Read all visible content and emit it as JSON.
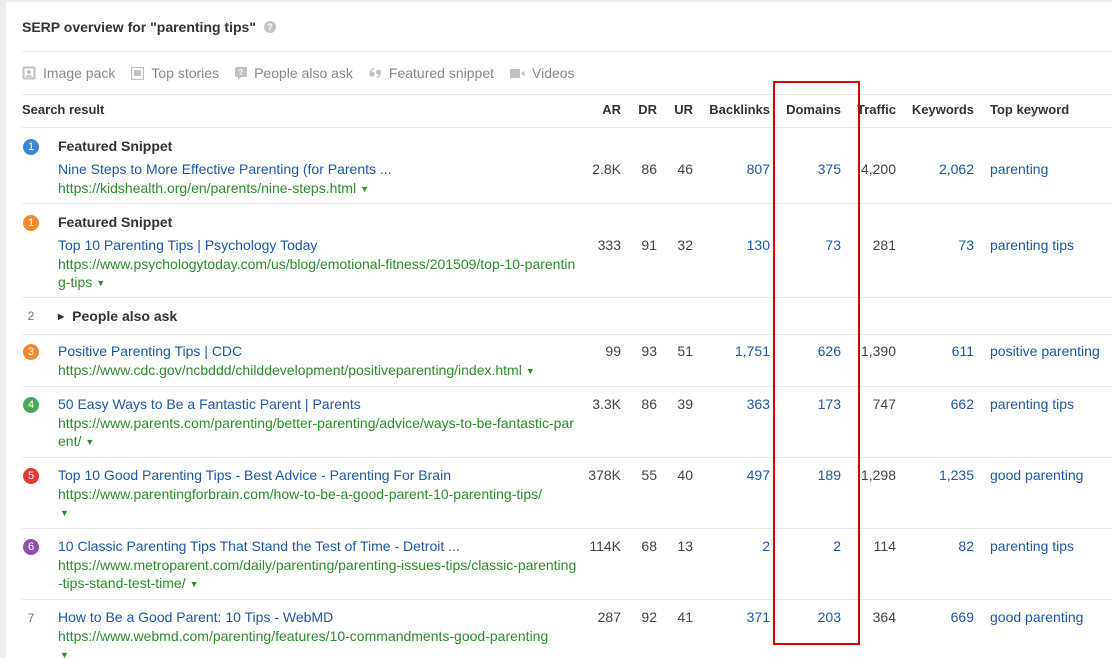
{
  "header": {
    "title": "SERP overview for \"parenting tips\"",
    "help_glyph": "?"
  },
  "filters": [
    {
      "label": "Image pack",
      "icon": "image-pack-icon"
    },
    {
      "label": "Top stories",
      "icon": "top-stories-icon"
    },
    {
      "label": "People also ask",
      "icon": "people-also-ask-icon"
    },
    {
      "label": "Featured snippet",
      "icon": "featured-snippet-icon"
    },
    {
      "label": "Videos",
      "icon": "videos-icon"
    }
  ],
  "columns": {
    "search_result": "Search result",
    "ar": "AR",
    "dr": "DR",
    "ur": "UR",
    "backlinks": "Backlinks",
    "domains": "Domains",
    "traffic": "Traffic",
    "keywords": "Keywords",
    "top_keyword": "Top keyword"
  },
  "colors": {
    "link": "#1f57a5",
    "url": "#2e8b2e",
    "highlight": "#e00000",
    "rank_blue": "#3b86d8",
    "rank_orange": "#f0892f",
    "rank_green": "#49a85a",
    "rank_red": "#e53a32",
    "rank_purple": "#8e4fae"
  },
  "rows": [
    {
      "rank": "1",
      "rank_color": "#3b86d8",
      "label": "Featured Snippet",
      "title": "Nine Steps to More Effective Parenting (for Parents ...",
      "url": "https://kidshealth.org/en/parents/nine-steps.html",
      "ar": "2.8K",
      "dr": "86",
      "ur": "46",
      "backlinks": "807",
      "domains": "375",
      "traffic": "4,200",
      "keywords": "2,062",
      "top_keyword": "parenting"
    },
    {
      "rank": "1",
      "rank_color": "#f0892f",
      "label": "Featured Snippet",
      "title": "Top 10 Parenting Tips | Psychology Today",
      "url": "https://www.psychologytoday.com/us/blog/emotional-fitness/201509/top-10-parenting-tips",
      "ar": "333",
      "dr": "91",
      "ur": "32",
      "backlinks": "130",
      "domains": "73",
      "traffic": "281",
      "keywords": "73",
      "top_keyword": "parenting tips"
    },
    {
      "rank": "2",
      "paa_label": "People also ask"
    },
    {
      "rank": "3",
      "rank_color": "#f0892f",
      "title": "Positive Parenting Tips | CDC",
      "url": "https://www.cdc.gov/ncbddd/childdevelopment/positiveparenting/index.html",
      "ar": "99",
      "dr": "93",
      "ur": "51",
      "backlinks": "1,751",
      "domains": "626",
      "traffic": "1,390",
      "keywords": "611",
      "top_keyword": "positive parenting"
    },
    {
      "rank": "4",
      "rank_color": "#49a85a",
      "title": "50 Easy Ways to Be a Fantastic Parent | Parents",
      "url": "https://www.parents.com/parenting/better-parenting/advice/ways-to-be-fantastic-parent/",
      "ar": "3.3K",
      "dr": "86",
      "ur": "39",
      "backlinks": "363",
      "domains": "173",
      "traffic": "747",
      "keywords": "662",
      "top_keyword": "parenting tips"
    },
    {
      "rank": "5",
      "rank_color": "#e53a32",
      "title": "Top 10 Good Parenting Tips - Best Advice - Parenting For Brain",
      "url": "https://www.parentingforbrain.com/how-to-be-a-good-parent-10-parenting-tips/",
      "ar": "378K",
      "dr": "55",
      "ur": "40",
      "backlinks": "497",
      "domains": "189",
      "traffic": "1,298",
      "keywords": "1,235",
      "top_keyword": "good parenting"
    },
    {
      "rank": "6",
      "rank_color": "#8e4fae",
      "title": "10 Classic Parenting Tips That Stand the Test of Time - Detroit ...",
      "url": "https://www.metroparent.com/daily/parenting/parenting-issues-tips/classic-parenting-tips-stand-test-time/",
      "ar": "114K",
      "dr": "68",
      "ur": "13",
      "backlinks": "2",
      "domains": "2",
      "traffic": "114",
      "keywords": "82",
      "top_keyword": "parenting tips"
    },
    {
      "rank": "7",
      "title": "How to Be a Good Parent: 10 Tips - WebMD",
      "url": "https://www.webmd.com/parenting/features/10-commandments-good-parenting",
      "ar": "287",
      "dr": "92",
      "ur": "41",
      "backlinks": "371",
      "domains": "203",
      "traffic": "364",
      "keywords": "669",
      "top_keyword": "good parenting"
    }
  ]
}
